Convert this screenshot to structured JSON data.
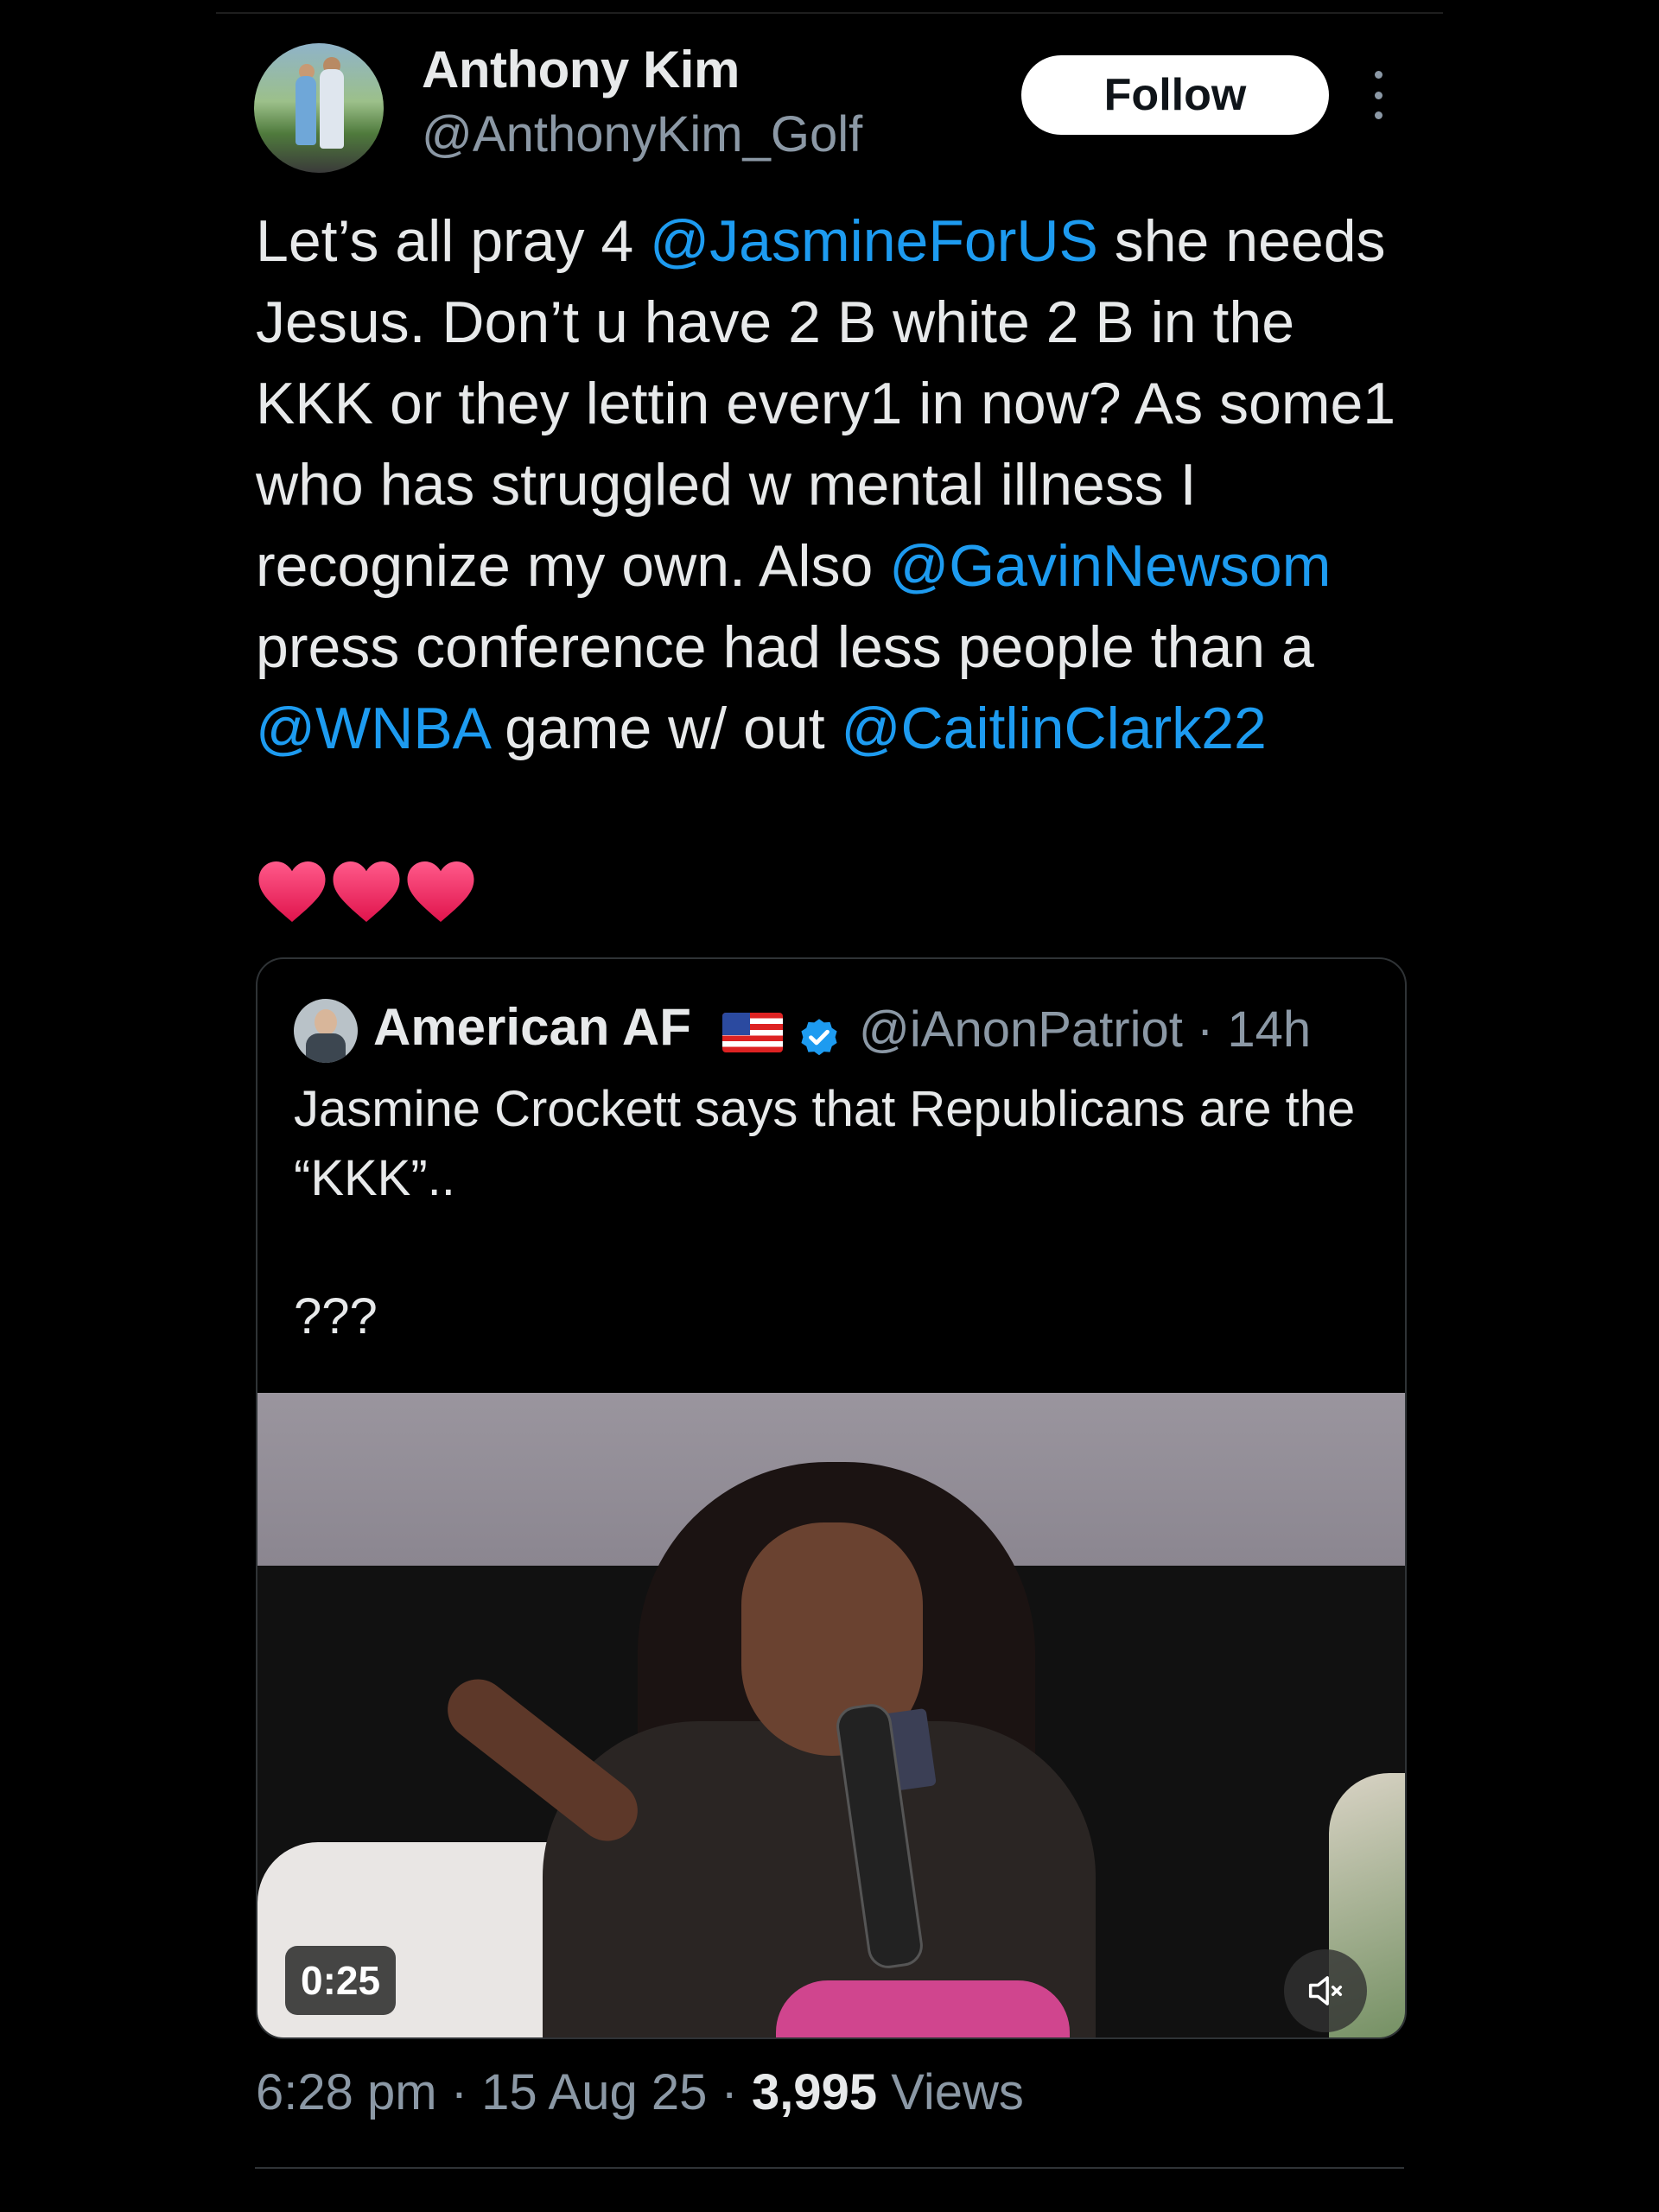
{
  "tweet": {
    "author_name": "Anthony Kim",
    "author_handle": "@AnthonyKim_Golf",
    "follow_label": "Follow",
    "text_parts": {
      "p1": "Let’s all pray 4 ",
      "m1": "@JasmineForUS",
      "p2": " she needs Jesus. Don’t u have 2 B white 2 B in the KKK or they lettin every1 in now? As some1 who has struggled w mental illness I recognize my own. Also ",
      "m2": "@GavinNewsom",
      "p3": " press conference had less people than a ",
      "m3": "@WNBA",
      "p4": " game w/ out ",
      "m4": "@CaitlinClark22"
    },
    "hearts_icon": "red-heart-emoji",
    "time": "6:28 pm",
    "sep1": " · ",
    "date": "15 Aug 25",
    "sep2": " · ",
    "views_count": "3,995",
    "views_label": " Views"
  },
  "quoted": {
    "author_name": "American AF",
    "flag_icon": "us-flag-emoji",
    "verified_icon": "verified-badge-icon",
    "verified_color": "#1d9bf0",
    "handle_time": "@iAnonPatriot · 14h",
    "text": "Jasmine Crockett says that Republicans are the “KKK”..\n\n???",
    "video": {
      "duration": "0:25",
      "mute_icon": "muted-speaker-icon"
    }
  },
  "colors": {
    "background": "#000000",
    "text": "#e7e9ea",
    "secondary": "#8b98a5",
    "link": "#1d9bf0",
    "border": "#2f3336"
  }
}
